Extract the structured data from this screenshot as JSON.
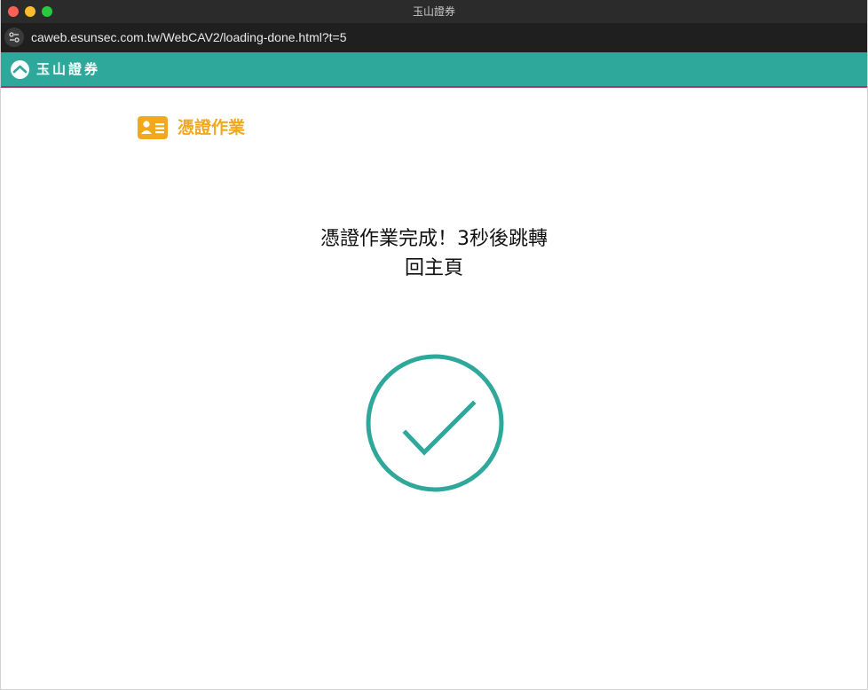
{
  "window": {
    "title": "玉山證券"
  },
  "browser": {
    "url": "caweb.esunsec.com.tw/WebCAV2/loading-done.html?t=5"
  },
  "site": {
    "brand": "玉山證券",
    "brand_color": "#2ea89b",
    "accent_line_color": "#b03070"
  },
  "section": {
    "icon": "id-card-icon",
    "title": "憑證作業",
    "title_color": "#f2a81d"
  },
  "status": {
    "line1": "憑證作業完成！3秒後跳轉",
    "line2": "回主頁",
    "icon": "check-circle-icon",
    "icon_color": "#2ea89b"
  }
}
